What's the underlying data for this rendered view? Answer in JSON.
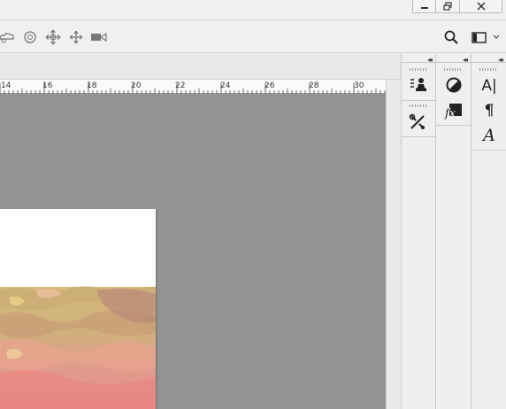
{
  "window": {
    "minimize_icon": "minimize-icon",
    "restore_icon": "restore-icon",
    "close_icon": "close-icon"
  },
  "options_bar": {
    "tools": [
      "lasso-cloud-icon",
      "rotate-3d-icon",
      "pan-3d-icon",
      "slide-3d-icon",
      "camera-3d-icon"
    ],
    "search_icon": "search-icon",
    "workspace_icon": "workspace-switcher-icon"
  },
  "ruler": {
    "labels": [
      "14",
      "16",
      "18",
      "20",
      "22",
      "24",
      "26",
      "28",
      "30"
    ]
  },
  "panels": {
    "collapse_glyph": "◂◂",
    "tool_presets_icon": "tool-presets-icon",
    "brush_settings_icon": "brush-tools-icon",
    "adjustments_icon": "adjustments-icon",
    "styles_icon": "fx-styles-icon",
    "character_glyph": "A|",
    "paragraph_glyph": "¶",
    "glyphs_glyph": "A"
  }
}
